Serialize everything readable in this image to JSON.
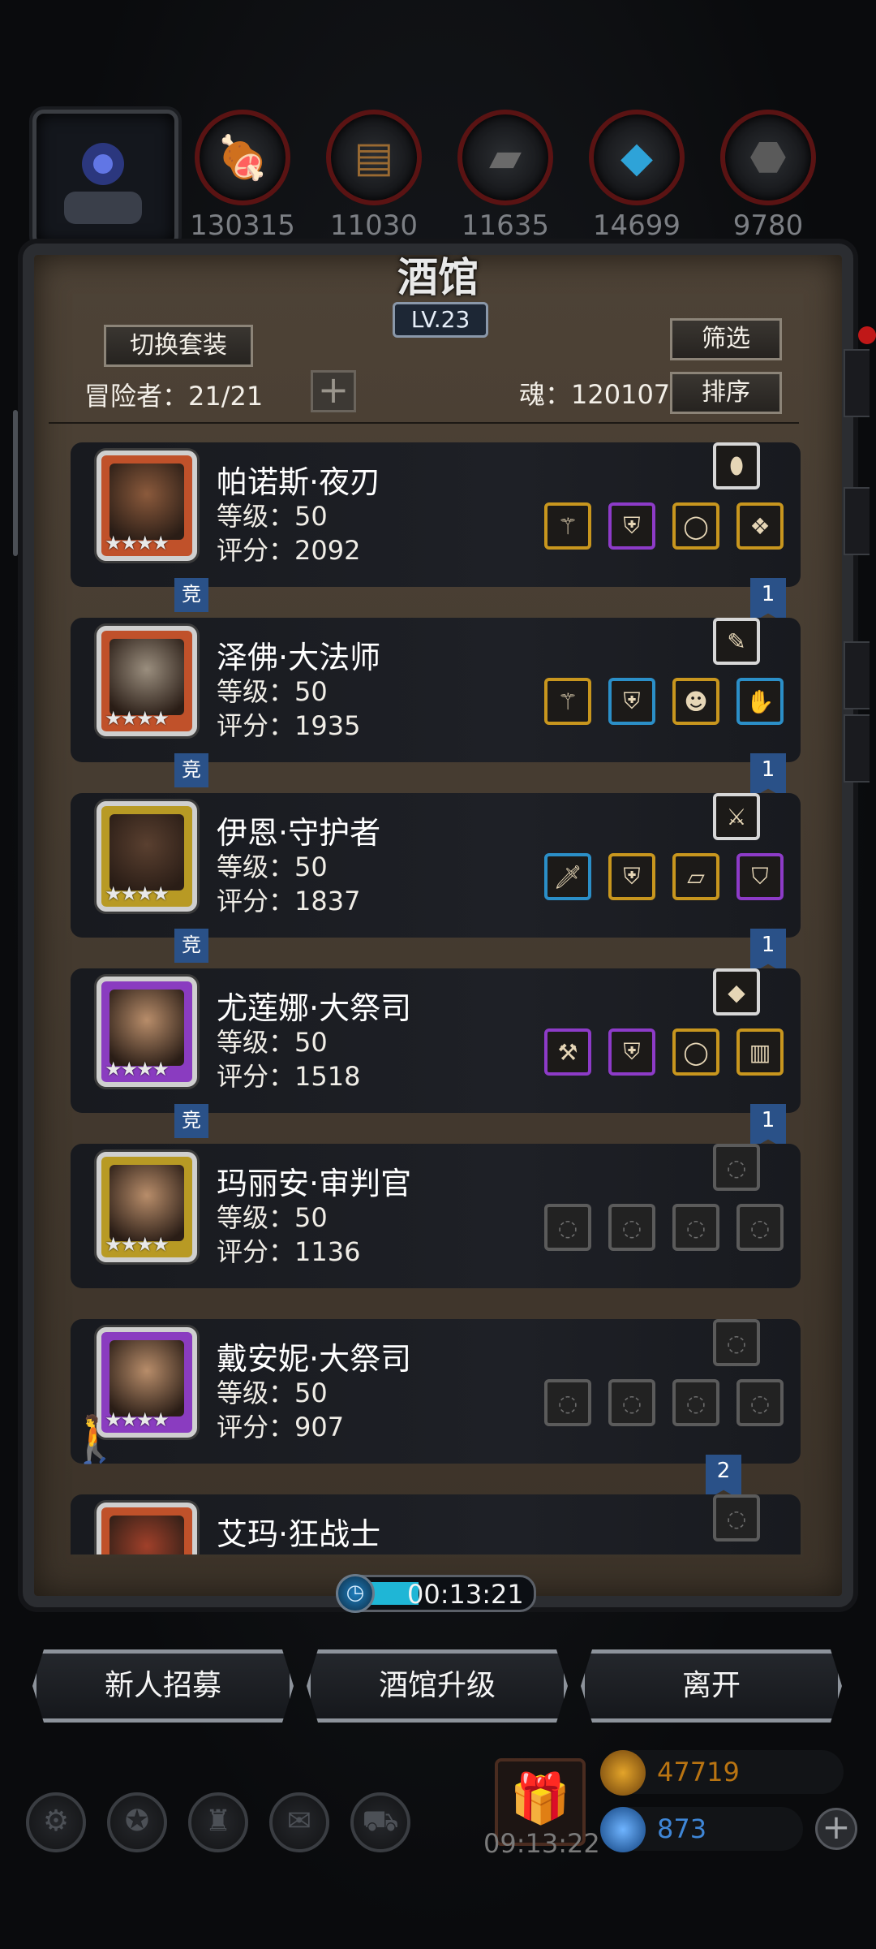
{
  "resources": [
    {
      "name": "meat-icon",
      "value": "130315"
    },
    {
      "name": "wood-icon",
      "value": "11030"
    },
    {
      "name": "iron-icon",
      "value": "11635"
    },
    {
      "name": "crystal-icon",
      "value": "14699"
    },
    {
      "name": "stone-icon",
      "value": "9780"
    }
  ],
  "panel": {
    "title": "酒馆",
    "level": "LV.23",
    "switch_set_label": "切换套装",
    "filter_label": "筛选",
    "sort_label": "排序",
    "adventurers_text": "冒险者：21/21",
    "plus_label": "+",
    "soul_text": "魂：120107"
  },
  "heroes": [
    {
      "name": "帕诺斯·夜刃",
      "level": "等级：50",
      "score": "评分：2092",
      "stars": "★★★★",
      "frame": "#c0512a",
      "tag": "竞",
      "ribbon": "1",
      "top_item": {
        "icon": "gem-icon",
        "rarity": "white"
      },
      "items": [
        {
          "icon": "staff-icon",
          "rarity": "gold"
        },
        {
          "icon": "armor-icon",
          "rarity": "purple"
        },
        {
          "icon": "ring-icon",
          "rarity": "gold"
        },
        {
          "icon": "amulet-icon",
          "rarity": "gold"
        }
      ]
    },
    {
      "name": "泽佛·大法师",
      "level": "等级：50",
      "score": "评分：1935",
      "stars": "★★★★",
      "frame": "#c0512a",
      "tag": "竞",
      "ribbon": "1",
      "top_item": {
        "icon": "feather-icon",
        "rarity": "white"
      },
      "items": [
        {
          "icon": "staff-icon",
          "rarity": "gold"
        },
        {
          "icon": "armor-icon",
          "rarity": "blue"
        },
        {
          "icon": "mask-icon",
          "rarity": "gold"
        },
        {
          "icon": "gauntlet-icon",
          "rarity": "blue"
        }
      ]
    },
    {
      "name": "伊恩·守护者",
      "level": "等级：50",
      "score": "评分：1837",
      "stars": "★★★★",
      "frame": "#b89a24",
      "tag": "竞",
      "ribbon": "1",
      "top_item": {
        "icon": "pistol-icon",
        "rarity": "white"
      },
      "items": [
        {
          "icon": "sword-icon",
          "rarity": "blue"
        },
        {
          "icon": "armor-icon",
          "rarity": "gold"
        },
        {
          "icon": "bracer-icon",
          "rarity": "gold"
        },
        {
          "icon": "shield-icon",
          "rarity": "purple"
        }
      ]
    },
    {
      "name": "尤莲娜·大祭司",
      "level": "等级：50",
      "score": "评分：1518",
      "stars": "★★★★",
      "frame": "#8a3cc0",
      "tag": "竞",
      "ribbon": "1",
      "top_item": {
        "icon": "crystal-icon",
        "rarity": "white"
      },
      "items": [
        {
          "icon": "hammer-icon",
          "rarity": "purple"
        },
        {
          "icon": "armor-icon",
          "rarity": "purple"
        },
        {
          "icon": "ring-icon",
          "rarity": "gold"
        },
        {
          "icon": "barrel-icon",
          "rarity": "gold"
        }
      ]
    },
    {
      "name": "玛丽安·审判官",
      "level": "等级：50",
      "score": "评分：1136",
      "stars": "★★★★",
      "frame": "#b89a24",
      "tag": "",
      "ribbon": "",
      "top_item": {
        "icon": "empty-slot-icon",
        "rarity": "empty"
      },
      "items": [
        {
          "icon": "empty-slot-icon",
          "rarity": "empty"
        },
        {
          "icon": "empty-slot-icon",
          "rarity": "empty"
        },
        {
          "icon": "empty-slot-icon",
          "rarity": "empty"
        },
        {
          "icon": "empty-slot-icon",
          "rarity": "empty"
        }
      ]
    },
    {
      "name": "戴安妮·大祭司",
      "level": "等级：50",
      "score": "评分：907",
      "stars": "★★★★",
      "frame": "#8a3cc0",
      "tag": "",
      "ribbon": "2",
      "top_item": {
        "icon": "empty-slot-icon",
        "rarity": "empty"
      },
      "items": [
        {
          "icon": "empty-slot-icon",
          "rarity": "empty"
        },
        {
          "icon": "empty-slot-icon",
          "rarity": "empty"
        },
        {
          "icon": "empty-slot-icon",
          "rarity": "empty"
        },
        {
          "icon": "empty-slot-icon",
          "rarity": "empty"
        }
      ]
    },
    {
      "name": "艾玛·狂战士",
      "level": "",
      "score": "",
      "stars": "",
      "frame": "#c0512a",
      "tag": "",
      "ribbon": "",
      "top_item": {
        "icon": "empty-slot-icon",
        "rarity": "empty"
      },
      "items": []
    }
  ],
  "timer": {
    "value": "00:13:21"
  },
  "buttons": {
    "recruit": "新人招募",
    "upgrade": "酒馆升级",
    "leave": "离开"
  },
  "dock": {
    "gift_timer": "09:13:22",
    "gold": "47719",
    "gems": "873",
    "add_label": "+"
  }
}
